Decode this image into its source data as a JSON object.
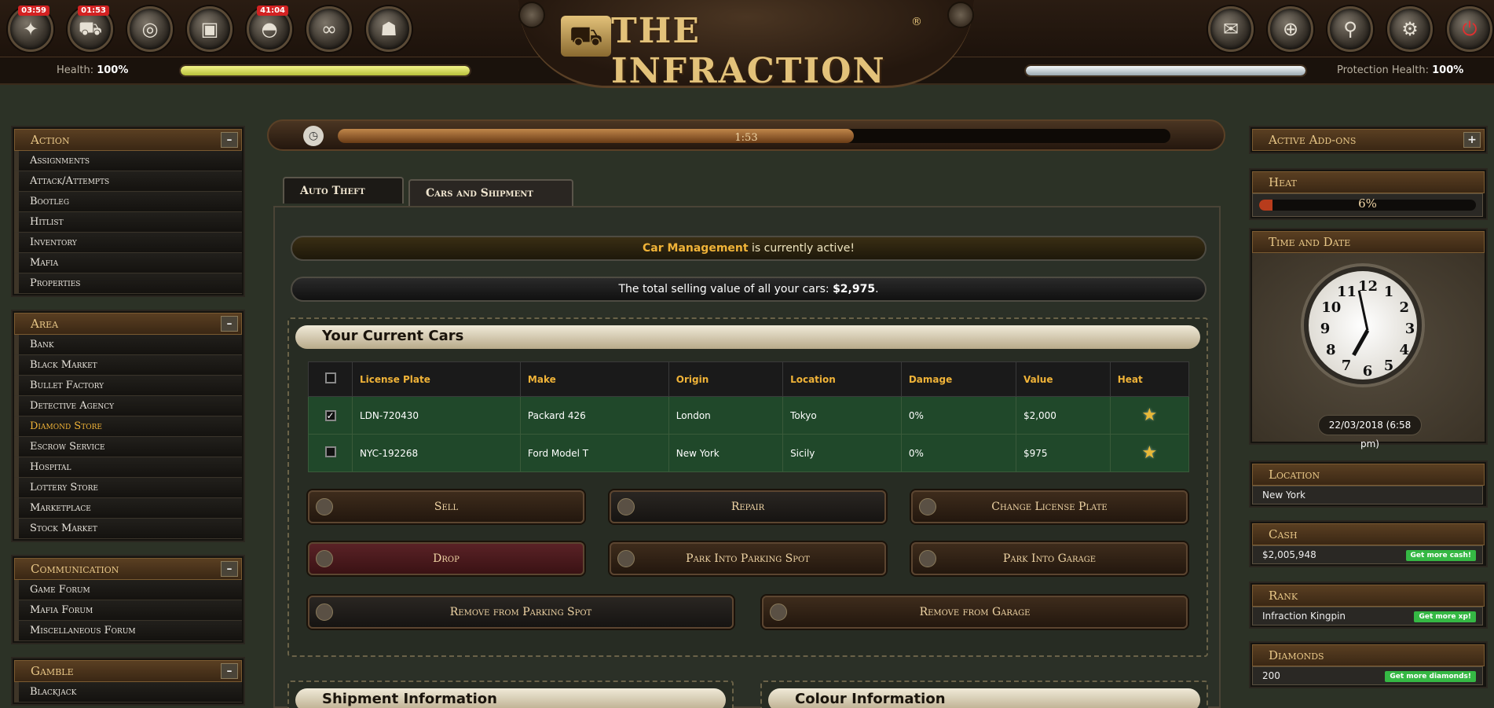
{
  "header": {
    "logo_text": "THE INFRACTION",
    "logo_mark": "®",
    "icons": [
      {
        "name": "gun-icon",
        "glyph": "✦",
        "timer": "03:59"
      },
      {
        "name": "car-icon",
        "glyph": "⛟",
        "timer": "01:53"
      },
      {
        "name": "binoculars-icon",
        "glyph": "◎",
        "timer": ""
      },
      {
        "name": "briefcase-icon",
        "glyph": "▣",
        "timer": ""
      },
      {
        "name": "helmet-icon",
        "glyph": "◓",
        "timer": "41:04"
      },
      {
        "name": "handcuffs-icon",
        "glyph": "∞",
        "timer": ""
      },
      {
        "name": "mobster-icon",
        "glyph": "☗",
        "timer": ""
      }
    ],
    "right_icons": [
      {
        "name": "mail-icon",
        "glyph": "✉"
      },
      {
        "name": "globe-icon",
        "glyph": "⊕"
      },
      {
        "name": "search-icon",
        "glyph": "⚲"
      },
      {
        "name": "settings-icon",
        "glyph": "⚙"
      },
      {
        "name": "power-icon",
        "glyph": "⏻"
      }
    ],
    "health_label": "Health:",
    "health_value": "100%",
    "protection_label": "Protection Health:",
    "protection_value": "100%",
    "health_fill": 1.0,
    "protection_fill": 1.0
  },
  "left": {
    "action": {
      "title": "Action",
      "toggle": "–",
      "items": [
        "Assignments",
        "Attack/Attempts",
        "Bootleg",
        "Hitlist",
        "Inventory",
        "Mafia",
        "Properties"
      ]
    },
    "area": {
      "title": "Area",
      "toggle": "–",
      "items": [
        "Bank",
        "Black Market",
        "Bullet Factory",
        "Detective Agency",
        "Diamond Store",
        "Escrow Service",
        "Hospital",
        "Lottery Store",
        "Marketplace",
        "Stock Market"
      ]
    },
    "communication": {
      "title": "Communication",
      "toggle": "–",
      "items": [
        "Game Forum",
        "Mafia Forum",
        "Miscellaneous Forum"
      ]
    },
    "gamble": {
      "title": "Gamble",
      "toggle": "–",
      "items": [
        "Blackjack"
      ]
    }
  },
  "progress": {
    "label": "1:53",
    "fill": 0.62
  },
  "tabs": [
    "Auto Theft",
    "Cars and Shipment"
  ],
  "notices": {
    "active_bold": "Car Management",
    "active_rest": " is currently active!",
    "total_prefix": "The total selling value of all your cars: ",
    "total_value": "$2,975",
    "total_suffix": "."
  },
  "cars": {
    "title": "Your Current Cars",
    "columns": [
      "License Plate",
      "Make",
      "Origin",
      "Location",
      "Damage",
      "Value",
      "Heat"
    ],
    "rows": [
      {
        "checked": true,
        "plate": "LDN-720430",
        "make": "Packard 426",
        "origin": "London",
        "location": "Tokyo",
        "damage": "0%",
        "value": "$2,000"
      },
      {
        "checked": false,
        "plate": "NYC-192268",
        "make": "Ford Model T",
        "origin": "New York",
        "location": "Sicily",
        "damage": "0%",
        "value": "$975"
      }
    ]
  },
  "actions": {
    "sell": "Sell",
    "repair": "Repair",
    "change_plate": "Change License Plate",
    "drop": "Drop",
    "park_spot": "Park Into Parking Spot",
    "park_garage": "Park Into Garage",
    "remove_spot": "Remove from Parking Spot",
    "remove_garage": "Remove from Garage"
  },
  "bottom": {
    "shipment": "Shipment Information",
    "colour": "Colour Information"
  },
  "right": {
    "addons": {
      "title": "Active Add-ons",
      "toggle": "+"
    },
    "heat": {
      "title": "Heat",
      "value": "6%",
      "fill": 0.06
    },
    "time": {
      "title": "Time and Date",
      "value": "22/03/2018 (6:58 pm)"
    },
    "location": {
      "title": "Location",
      "value": "New York"
    },
    "cash": {
      "title": "Cash",
      "value": "$2,005,948",
      "button": "Get more cash!"
    },
    "rank": {
      "title": "Rank",
      "value": "Infraction Kingpin",
      "button": "Get more xp!"
    },
    "diamonds": {
      "title": "Diamonds",
      "value": "200",
      "button": "Get more diamonds!"
    }
  },
  "colors": {
    "accent": "#f0b338",
    "row_green": "#20482a",
    "button_green": "#35b844"
  }
}
